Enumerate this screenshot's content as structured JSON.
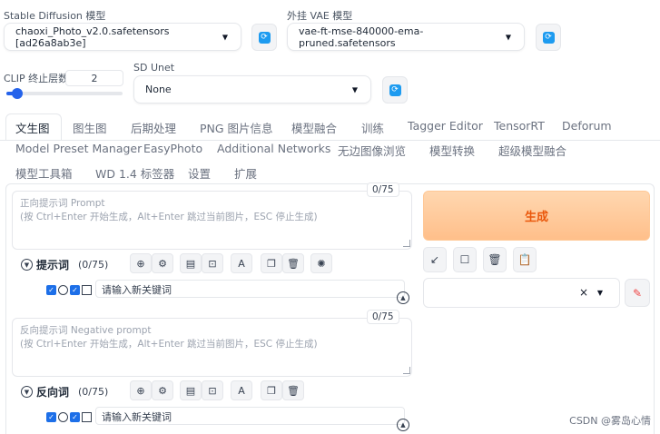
{
  "settings": {
    "model_label": "Stable Diffusion 模型",
    "model_value": "chaoxi_Photo_v2.0.safetensors [ad26a8ab3e]",
    "vae_label": "外挂 VAE 模型",
    "vae_value": "vae-ft-mse-840000-ema-pruned.safetensors",
    "clip_label": "CLIP 终止层数",
    "clip_value": "2",
    "clip_slider_fraction": 0.09,
    "unet_label": "SD Unet",
    "unet_value": "None"
  },
  "tabs": {
    "row1": [
      "文生图",
      "图生图",
      "后期处理",
      "PNG 图片信息",
      "模型融合",
      "训练",
      "Tagger Editor",
      "TensorRT",
      "Deforum"
    ],
    "row2": [
      "Model Preset Manager",
      "EasyPhoto",
      "Additional Networks",
      "无边图像浏览",
      "模型转换",
      "超级模型融合"
    ],
    "row3": [
      "模型工具箱",
      "WD 1.4 标签器",
      "设置",
      "扩展"
    ],
    "active": "文生图"
  },
  "prompt": {
    "placeholder": "正向提示词 Prompt\n(按 Ctrl+Enter 开始生成，Alt+Enter 跳过当前图片，ESC 停止生成)",
    "counter": "0/75",
    "section_title": "提示词",
    "section_count": "(0/75)",
    "keyword_placeholder": "请输入新关键词"
  },
  "negative": {
    "placeholder": "反向提示词 Negative prompt\n(按 Ctrl+Enter 开始生成，Alt+Enter 跳过当前图片，ESC 停止生成)",
    "counter": "0/75",
    "section_title": "反向词",
    "section_count": "(0/75)",
    "keyword_placeholder": "请输入新关键词"
  },
  "actions": {
    "generate_label": "生成"
  },
  "watermark": "CSDN @雾岛心情"
}
